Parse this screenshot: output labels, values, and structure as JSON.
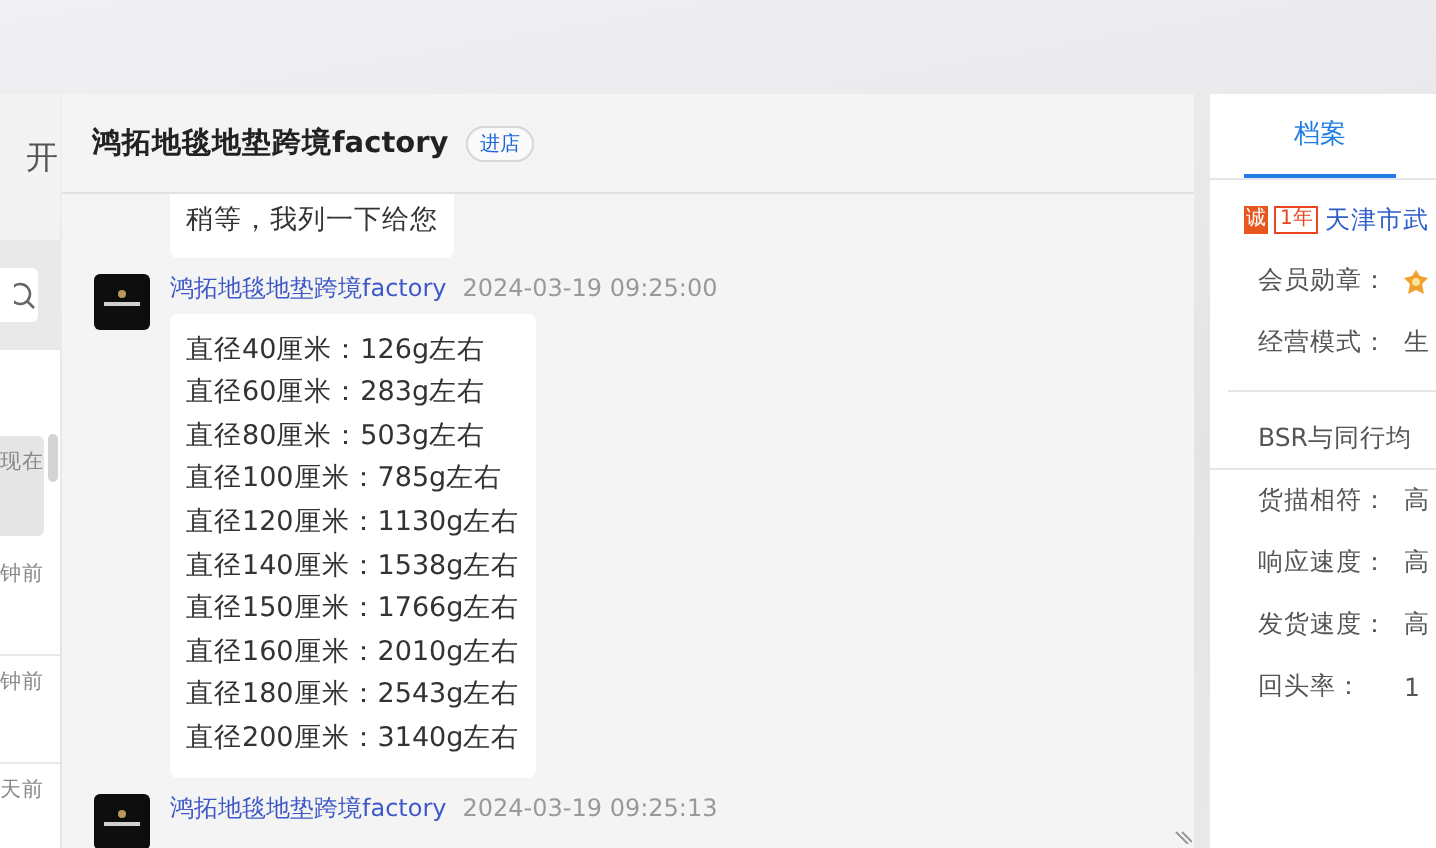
{
  "sidebar": {
    "heading_fragment": "开",
    "items": [
      {
        "time": "现在",
        "selected": true
      },
      {
        "time": "钟前",
        "selected": false
      },
      {
        "time": "钟前",
        "selected": false
      },
      {
        "time": "天前",
        "selected": false
      }
    ]
  },
  "chat": {
    "title": "鸿拓地毯地垫跨境factory",
    "store_button": "进店",
    "messages": [
      {
        "kind": "continued",
        "lines": [
          "稍等，我列一下给您"
        ]
      },
      {
        "kind": "full",
        "sender": "鸿拓地毯地垫跨境factory",
        "time": "2024-03-19 09:25:00",
        "lines": [
          "直径40厘米：126g左右",
          "直径60厘米：283g左右",
          "直径80厘米：503g左右",
          "直径100厘米：785g左右",
          "直径120厘米：1130g左右",
          "直径140厘米：1538g左右",
          "直径150厘米：1766g左右",
          "直径160厘米：2010g左右",
          "直径180厘米：2543g左右",
          "直径200厘米：3140g左右"
        ]
      },
      {
        "kind": "header_only",
        "sender": "鸿拓地毯地垫跨境factory",
        "time": "2024-03-19 09:25:13"
      }
    ]
  },
  "profile": {
    "tabs": [
      {
        "label": "档案",
        "selected": true
      }
    ],
    "badge_mark": "诚",
    "badge_years": "1年",
    "company": "天津市武",
    "fields": [
      {
        "kind": "medal",
        "label": "会员勋章："
      },
      {
        "kind": "text",
        "label": "经营模式：",
        "value": "生"
      }
    ],
    "bsr_title": "BSR与同行均",
    "ratings": [
      {
        "label": "货描相符：",
        "value": "高"
      },
      {
        "label": "响应速度：",
        "value": "高"
      },
      {
        "label": "发货速度：",
        "value": "高"
      },
      {
        "label": "回头率：",
        "value": "1"
      }
    ]
  }
}
